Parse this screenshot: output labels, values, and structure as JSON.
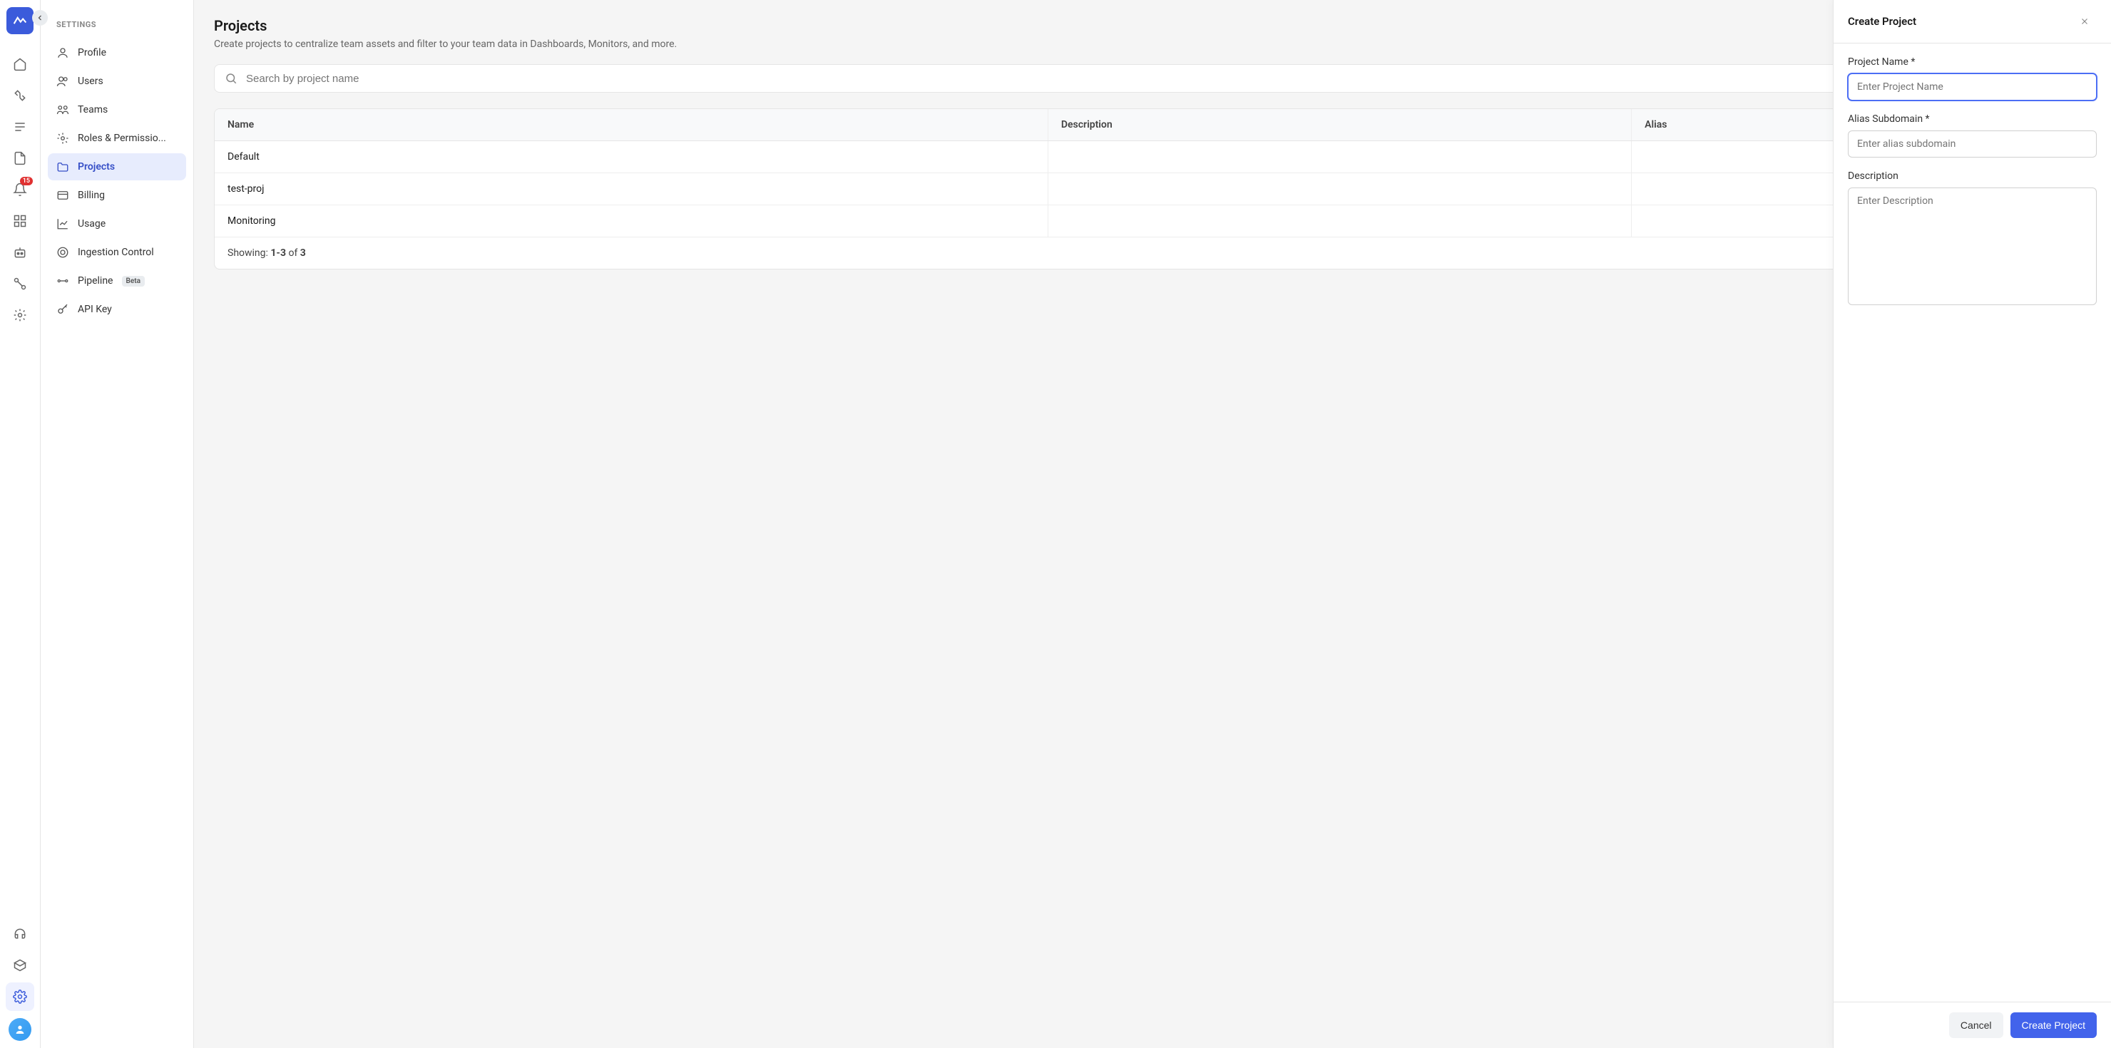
{
  "rail": {
    "badge_count": "15"
  },
  "sidebar": {
    "heading": "SETTINGS",
    "items": [
      {
        "label": "Profile"
      },
      {
        "label": "Users"
      },
      {
        "label": "Teams"
      },
      {
        "label": "Roles & Permissio..."
      },
      {
        "label": "Projects"
      },
      {
        "label": "Billing"
      },
      {
        "label": "Usage"
      },
      {
        "label": "Ingestion Control"
      },
      {
        "label": "Pipeline",
        "badge": "Beta"
      },
      {
        "label": "API Key"
      }
    ]
  },
  "main": {
    "title": "Projects",
    "subtitle": "Create projects to centralize team assets and filter to your team data in Dashboards, Monitors, and more.",
    "search_placeholder": "Search by project name",
    "columns": {
      "name": "Name",
      "description": "Description",
      "alias": "Alias"
    },
    "rows": [
      {
        "name": "Default",
        "description": "",
        "alias": ""
      },
      {
        "name": "test-proj",
        "description": "",
        "alias": ""
      },
      {
        "name": "Monitoring",
        "description": "",
        "alias": ""
      }
    ],
    "footer_prefix": "Showing: ",
    "footer_range": "1-3",
    "footer_mid": " of ",
    "footer_total": "3"
  },
  "drawer": {
    "title": "Create Project",
    "fields": {
      "name_label": "Project Name *",
      "name_placeholder": "Enter Project Name",
      "alias_label": "Alias Subdomain *",
      "alias_placeholder": "Enter alias subdomain",
      "desc_label": "Description",
      "desc_placeholder": "Enter Description"
    },
    "cancel": "Cancel",
    "submit": "Create Project"
  }
}
